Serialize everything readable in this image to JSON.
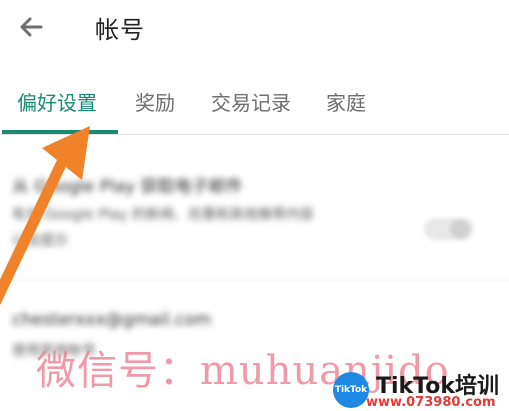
{
  "header": {
    "title": "帐号",
    "back_icon": "arrow-left-icon"
  },
  "tabs": [
    {
      "label": "偏好设置",
      "active": true
    },
    {
      "label": "奖励",
      "active": false
    },
    {
      "label": "交易记录",
      "active": false
    },
    {
      "label": "家庭",
      "active": false
    }
  ],
  "content": {
    "section1_title": "从 Google Play 获取电子邮件",
    "section1_desc_line1": "有关 Google Play 的新闻、优惠和其他推荐内容",
    "section1_desc_line2": "以及提示",
    "section2_title": "chesterxxx@gmail.com",
    "section2_sub": "使用其他帐号"
  },
  "overlay": {
    "watermark": "微信号：muhuanjido",
    "brand_name": "TikTok培训",
    "brand_url": "www.073980.com",
    "logo_text": "TikTok"
  },
  "colors": {
    "accent": "#1a8a73",
    "arrow": "#f0822a",
    "watermark": "#eb788c",
    "brand_url": "#e53935"
  }
}
